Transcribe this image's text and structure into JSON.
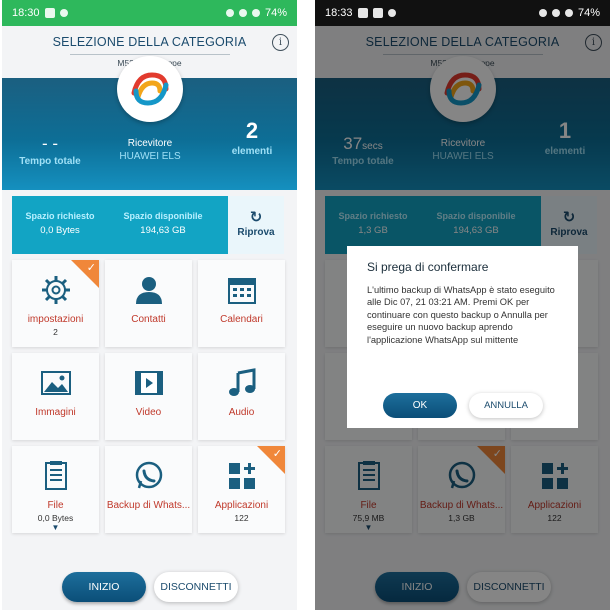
{
  "screens": [
    {
      "status": {
        "time": "18:30",
        "battery": "74%"
      },
      "header": {
        "title": "SELEZIONE DELLA CATEGORIA",
        "device": "M52 di Giuseppe"
      },
      "stats": {
        "time_value": "- -",
        "time_unit": "",
        "time_label": "Tempo totale",
        "receiver_label": "Ricevitore",
        "receiver_name": "HUAWEI ELS",
        "items_value": "2",
        "items_label": "elementi"
      },
      "space": {
        "required_label": "Spazio richiesto",
        "required_value": "0,0 Bytes",
        "available_label": "Spazio disponibile",
        "available_value": "194,63 GB",
        "retry_label": "Riprova"
      },
      "tiles": [
        {
          "label": "impostazioni",
          "sub": "2",
          "icon": "gear-icon",
          "checked": true
        },
        {
          "label": "Contatti",
          "sub": "",
          "icon": "contact-icon",
          "checked": false
        },
        {
          "label": "Calendari",
          "sub": "",
          "icon": "calendar-icon",
          "checked": false
        },
        {
          "label": "Immagini",
          "sub": "",
          "icon": "image-icon",
          "checked": false
        },
        {
          "label": "Video",
          "sub": "",
          "icon": "video-icon",
          "checked": false
        },
        {
          "label": "Audio",
          "sub": "",
          "icon": "music-icon",
          "checked": false
        },
        {
          "label": "File",
          "sub": "0,0 Bytes",
          "icon": "file-icon",
          "checked": false
        },
        {
          "label": "Backup di Whats...",
          "sub": "",
          "icon": "whatsapp-icon",
          "checked": false
        },
        {
          "label": "Applicazioni",
          "sub": "122",
          "icon": "apps-icon",
          "checked": true
        }
      ],
      "buttons": {
        "start": "INIZIO",
        "disconnect": "DISCONNETTI"
      }
    },
    {
      "status": {
        "time": "18:33",
        "battery": "74%"
      },
      "header": {
        "title": "SELEZIONE DELLA CATEGORIA",
        "device": "M52 di Giuseppe"
      },
      "stats": {
        "time_value": "37",
        "time_unit": "secs",
        "time_label": "Tempo totale",
        "receiver_label": "Ricevitore",
        "receiver_name": "HUAWEI ELS",
        "items_value": "1",
        "items_label": "elementi"
      },
      "space": {
        "required_label": "Spazio richiesto",
        "required_value": "1,3 GB",
        "available_label": "Spazio disponibile",
        "available_value": "194,63 GB",
        "retry_label": "Riprova"
      },
      "tiles": [
        {
          "label": "",
          "sub": "",
          "icon": "",
          "checked": false
        },
        {
          "label": "",
          "sub": "",
          "icon": "",
          "checked": false
        },
        {
          "label": "",
          "sub": "",
          "icon": "",
          "checked": false
        },
        {
          "label": "",
          "sub": "",
          "icon": "",
          "checked": false
        },
        {
          "label": "",
          "sub": "",
          "icon": "",
          "checked": false
        },
        {
          "label": "",
          "sub": "",
          "icon": "",
          "checked": false
        },
        {
          "label": "File",
          "sub": "75,9 MB",
          "icon": "file-icon",
          "checked": false
        },
        {
          "label": "Backup di Whats...",
          "sub": "1,3 GB",
          "icon": "whatsapp-icon",
          "checked": true
        },
        {
          "label": "Applicazioni",
          "sub": "122",
          "icon": "apps-icon",
          "checked": false
        }
      ],
      "buttons": {
        "start": "INIZIO",
        "disconnect": "DISCONNETTI"
      },
      "dialog": {
        "title": "Si prega di confermare",
        "message": "L'ultimo backup di WhatsApp è stato eseguito alle Dic 07, 21 03:21 AM. Premi OK per continuare con questo backup o Annulla per eseguire un nuovo backup aprendo l'applicazione WhatsApp sul mittente",
        "ok": "OK",
        "cancel": "ANNULLA"
      }
    }
  ],
  "colors": {
    "accent": "#0b4e78",
    "checked_corner": "#f0873a",
    "tile_label": "#c0392b",
    "space_bar": "#12a4c4"
  }
}
